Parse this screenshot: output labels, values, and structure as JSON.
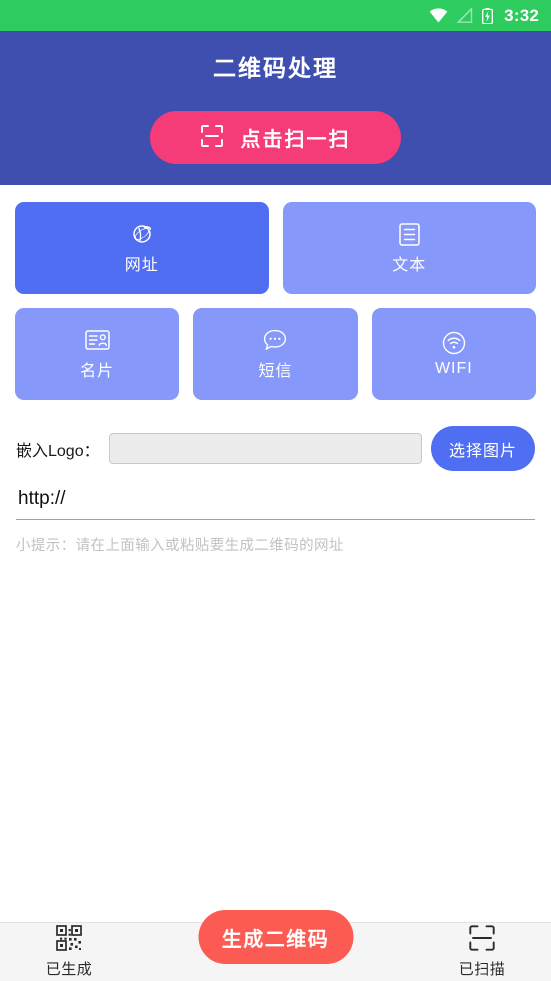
{
  "statusbar": {
    "time": "3:32",
    "icons": [
      "wifi-icon",
      "signal-off-icon",
      "battery-charging-icon"
    ]
  },
  "header": {
    "title": "二维码处理",
    "scan_button": {
      "label": "点击扫一扫",
      "icon": "scan-frame-icon"
    },
    "background_color": "#3f4fb0",
    "scan_button_color": "#f63c78"
  },
  "type_tabs": {
    "selected": "网址",
    "rows": [
      [
        {
          "label": "网址",
          "icon": "globe-link-icon",
          "active": true
        },
        {
          "label": "文本",
          "icon": "document-text-icon",
          "active": false
        }
      ],
      [
        {
          "label": "名片",
          "icon": "business-card-icon",
          "active": false
        },
        {
          "label": "短信",
          "icon": "sms-bubble-icon",
          "active": false
        },
        {
          "label": "WIFI",
          "icon": "wifi-circle-icon",
          "active": false
        }
      ]
    ],
    "active_color": "#4f6ef2",
    "inactive_color": "#8698f9"
  },
  "logo_row": {
    "label": "嵌入Logo：",
    "input_value": "",
    "input_placeholder": "",
    "pick_button_label": "选择图片"
  },
  "url_field": {
    "value": "http://",
    "placeholder": "http://"
  },
  "hint": "小提示：请在上面输入或粘贴要生成二维码的网址",
  "bottombar": {
    "left_tab": {
      "label": "已生成",
      "icon": "qrcode-icon"
    },
    "right_tab": {
      "label": "已扫描",
      "icon": "scan-line-icon"
    },
    "generate_button": {
      "label": "生成二维码",
      "color": "#fb5b52"
    }
  }
}
